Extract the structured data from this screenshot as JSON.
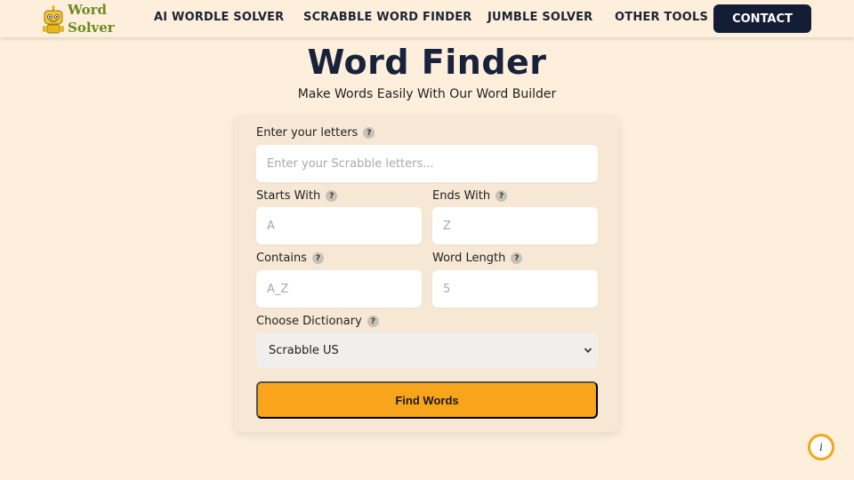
{
  "brand": {
    "line1": "Word",
    "line2": "Solver",
    "mascot_icon": "robot-mascot-icon",
    "color": "#6d8a1e"
  },
  "nav": {
    "links": [
      "AI WORDLE SOLVER",
      "SCRABBLE WORD FINDER",
      "JUMBLE SOLVER",
      "OTHER TOOLS"
    ],
    "contact_label": "CONTACT",
    "contact_color": "#131d36"
  },
  "hero": {
    "title": "Word Finder",
    "subtitle": "Make Words Easily With Our Word Builder"
  },
  "form": {
    "letters": {
      "label": "Enter your letters",
      "placeholder": "Enter your Scrabble letters...",
      "value": ""
    },
    "starts_with": {
      "label": "Starts With",
      "placeholder": "A",
      "value": ""
    },
    "ends_with": {
      "label": "Ends With",
      "placeholder": "Z",
      "value": ""
    },
    "contains": {
      "label": "Contains",
      "placeholder": "A_Z",
      "value": ""
    },
    "word_length": {
      "label": "Word Length",
      "placeholder": "5",
      "value": ""
    },
    "dictionary": {
      "label": "Choose Dictionary",
      "selected": "Scrabble US"
    },
    "help_glyph": "?",
    "submit_label": "Find Words",
    "submit_color": "#f9a51c"
  },
  "info_button": {
    "glyph": "i",
    "icon": "info-icon"
  },
  "colors": {
    "background": "#fdefdc",
    "card": "#f7e8d6",
    "title": "#18223a"
  }
}
